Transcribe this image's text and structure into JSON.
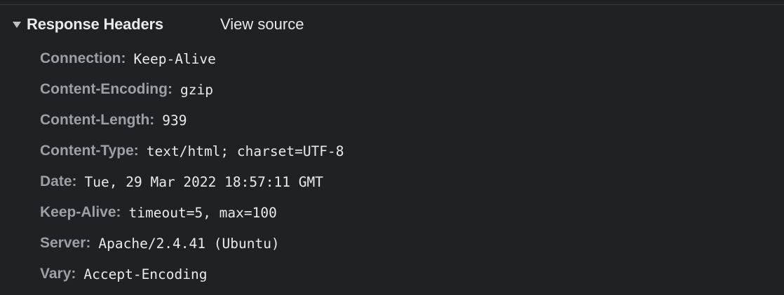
{
  "section": {
    "title": "Response Headers",
    "view_source_label": "View source"
  },
  "headers": [
    {
      "name": "Connection",
      "value": "Keep-Alive"
    },
    {
      "name": "Content-Encoding",
      "value": "gzip"
    },
    {
      "name": "Content-Length",
      "value": "939"
    },
    {
      "name": "Content-Type",
      "value": "text/html; charset=UTF-8"
    },
    {
      "name": "Date",
      "value": "Tue, 29 Mar 2022 18:57:11 GMT"
    },
    {
      "name": "Keep-Alive",
      "value": "timeout=5, max=100"
    },
    {
      "name": "Server",
      "value": "Apache/2.4.41 (Ubuntu)"
    },
    {
      "name": "Vary",
      "value": "Accept-Encoding"
    }
  ],
  "colors": {
    "background": "#202124",
    "header_name": "#9aa0a6",
    "header_value": "#e8eaed",
    "title": "#e8eaed"
  },
  "icons": {
    "disclosure": "triangle-down-icon"
  }
}
